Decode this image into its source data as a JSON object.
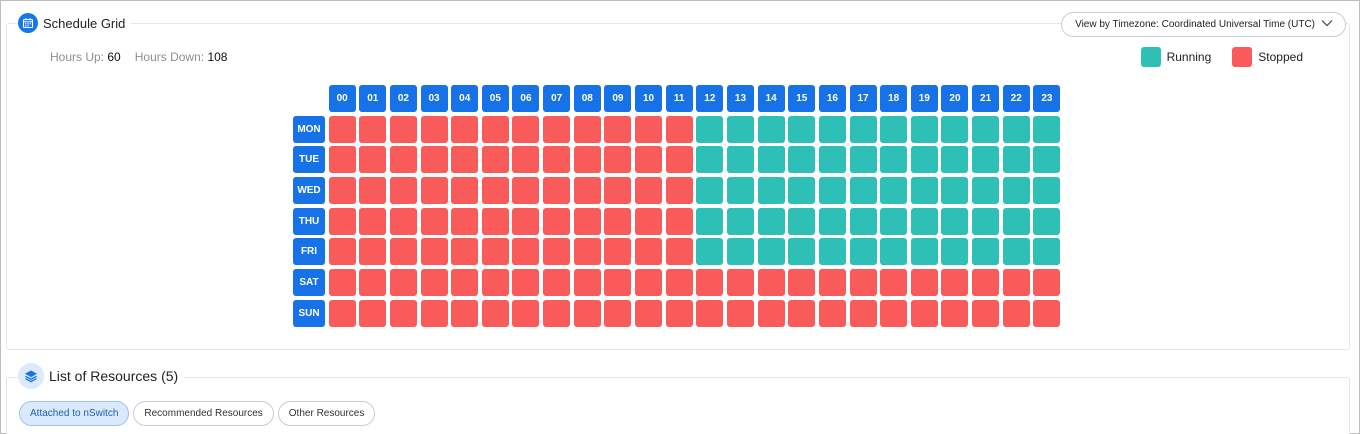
{
  "schedule": {
    "title": "Schedule Grid",
    "timezone_label": "View by Timezone: Coordinated Universal Time (UTC)",
    "hours_up_label": "Hours Up:",
    "hours_up_value": "60",
    "hours_down_label": "Hours Down:",
    "hours_down_value": "108",
    "legend": [
      {
        "label": "Running",
        "color": "#2ec0b6"
      },
      {
        "label": "Stopped",
        "color": "#f85b5a"
      }
    ],
    "hours": [
      "00",
      "01",
      "02",
      "03",
      "04",
      "05",
      "06",
      "07",
      "08",
      "09",
      "10",
      "11",
      "12",
      "13",
      "14",
      "15",
      "16",
      "17",
      "18",
      "19",
      "20",
      "21",
      "22",
      "23"
    ],
    "days": [
      {
        "label": "MON",
        "running_from": 12,
        "running_to": 23
      },
      {
        "label": "TUE",
        "running_from": 12,
        "running_to": 23
      },
      {
        "label": "WED",
        "running_from": 12,
        "running_to": 23
      },
      {
        "label": "THU",
        "running_from": 12,
        "running_to": 23
      },
      {
        "label": "FRI",
        "running_from": 12,
        "running_to": 23
      },
      {
        "label": "SAT",
        "running_from": null,
        "running_to": null
      },
      {
        "label": "SUN",
        "running_from": null,
        "running_to": null
      }
    ],
    "colors": {
      "running": "#2ec0b6",
      "stopped": "#f85b5a",
      "header": "#1672e6"
    }
  },
  "resources": {
    "title": "List of Resources",
    "count": "(5)",
    "tabs": [
      {
        "label": "Attached to nSwitch",
        "active": true
      },
      {
        "label": "Recommended Resources",
        "active": false
      },
      {
        "label": "Other Resources",
        "active": false
      }
    ]
  },
  "icons": {
    "schedule": "calendar-icon",
    "resources": "layers-icon",
    "timezone_dropdown": "chevron-down-icon"
  }
}
